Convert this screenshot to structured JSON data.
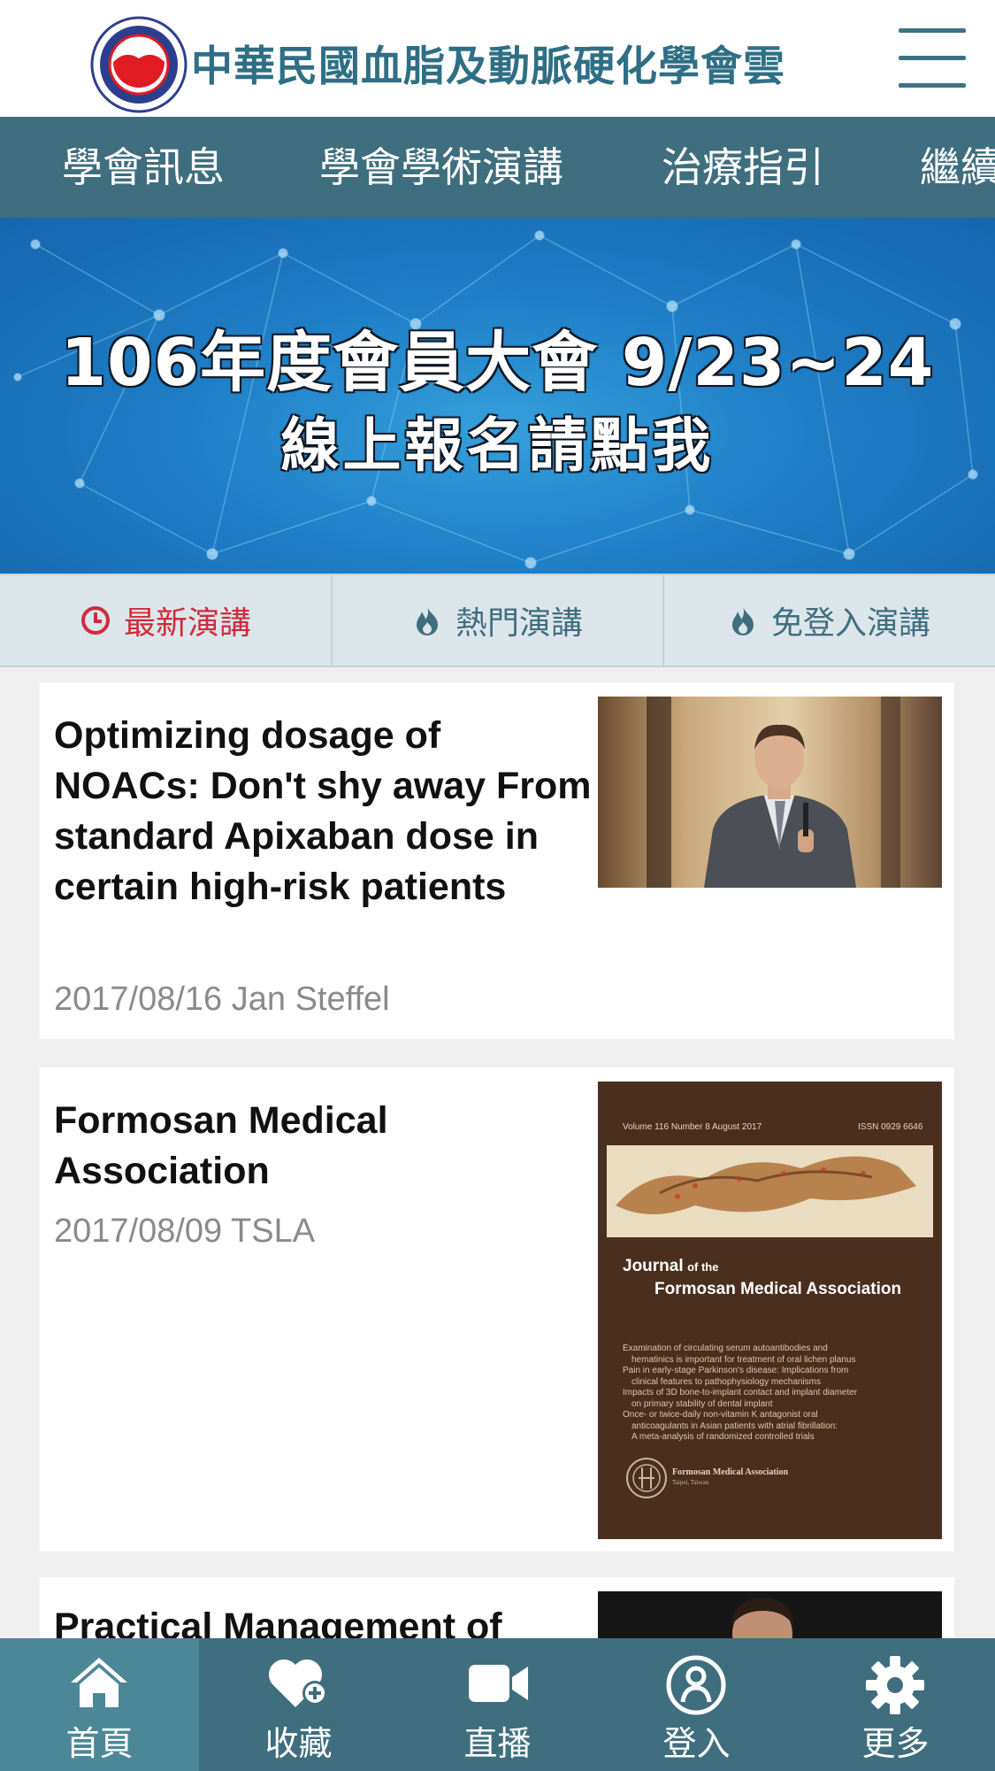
{
  "header": {
    "title": "中華民國血脂及動脈硬化學會雲",
    "logo_icon": "society-logo-icon",
    "menu_icon": "hamburger-menu-icon"
  },
  "nav": {
    "items": [
      {
        "label": "學會訊息"
      },
      {
        "label": "學會學術演講"
      },
      {
        "label": "治療指引"
      },
      {
        "label": "繼續"
      }
    ]
  },
  "banner": {
    "line1": "106年度會員大會 9/23~24",
    "line2": "線上報名請點我"
  },
  "tabs": [
    {
      "label": "最新演講",
      "icon": "clock-icon",
      "active": true
    },
    {
      "label": "熱門演講",
      "icon": "fire-icon",
      "active": false
    },
    {
      "label": "免登入演講",
      "icon": "fire-icon",
      "active": false
    }
  ],
  "cards": [
    {
      "title": "Optimizing dosage of NOACs: Don't shy away From standard Apixaban dose in certain high-risk patients",
      "meta": "2017/08/16 Jan Steffel"
    },
    {
      "title": "Formosan Medical Association",
      "meta": "2017/08/09 TSLA",
      "cover": {
        "top_left": "Volume 116 Number 8 August 2017",
        "top_right": "ISSN 0929 6646",
        "journal_small": "Journal",
        "journal_of": "of the",
        "journal_name": "Formosan Medical Association",
        "contents": [
          "Examination of circulating serum autoantibodies and",
          "hematinics is important for treatment of oral lichen planus",
          "Pain in early-stage Parkinson's disease: Implications from",
          "clinical features to pathophysiology mechanisms",
          "Impacts of 3D bone-to-implant contact and implant diameter",
          "on primary stability of dental implant",
          "Once- or twice-daily non-vitamin K antagonist oral",
          "anticoagulants in Asian patients with atrial fibrillation:",
          "A meta-analysis of randomized controlled trials"
        ],
        "publisher": "Formosan Medical Association",
        "publisher_city": "Taipei, Taiwan"
      }
    },
    {
      "title": "Practical Management of",
      "meta": ""
    }
  ],
  "bottom_nav": [
    {
      "label": "首頁",
      "icon": "home-icon",
      "active": true
    },
    {
      "label": "收藏",
      "icon": "heart-plus-icon",
      "active": false
    },
    {
      "label": "直播",
      "icon": "video-camera-icon",
      "active": false
    },
    {
      "label": "登入",
      "icon": "user-circle-icon",
      "active": false
    },
    {
      "label": "更多",
      "icon": "gear-icon",
      "active": false
    }
  ],
  "colors": {
    "nav_bg": "#3f6e7e",
    "title_color": "#2f6f86",
    "active_tab": "#cf2b3a",
    "banner_blue": "#1e7ec6"
  }
}
